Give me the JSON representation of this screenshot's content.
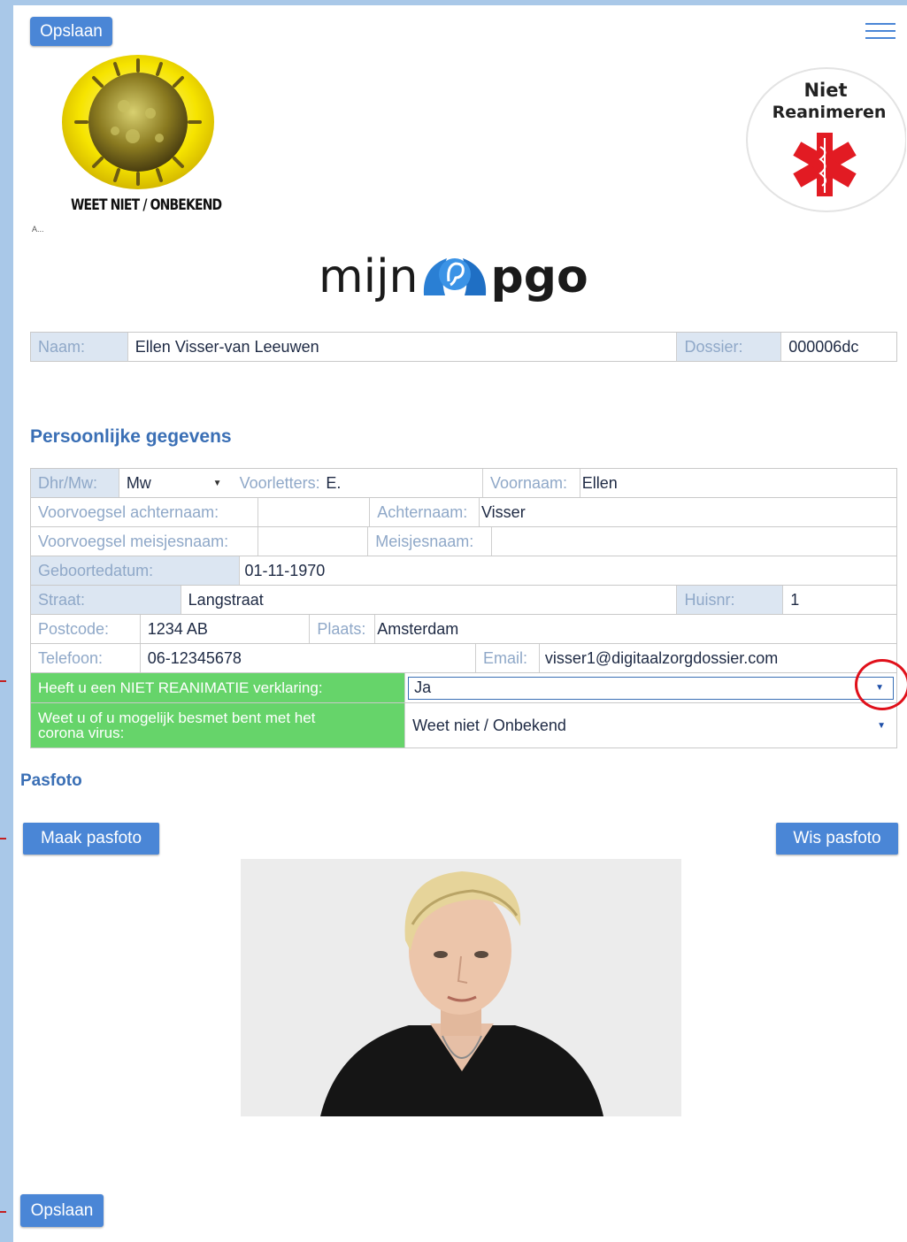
{
  "toolbar": {
    "save_label": "Opslaan"
  },
  "badges": {
    "corona_label": "WEET NIET / ONBEKEND",
    "tiny_mark": "A...",
    "nr_line1": "Niet",
    "nr_line2": "Reanimeren"
  },
  "logo": {
    "word1": "mijn",
    "word2": "pgo"
  },
  "header": {
    "naam_label": "Naam:",
    "naam_value": "Ellen Visser-van Leeuwen",
    "dossier_label": "Dossier:",
    "dossier_value": "000006dc"
  },
  "section_title": "Persoonlijke gegevens",
  "form": {
    "dhr_label": "Dhr/Mw:",
    "dhr_value": "Mw",
    "voorletters_label": "Voorletters:",
    "voorletters_value": "E.",
    "voornaam_label": "Voornaam:",
    "voornaam_value": "Ellen",
    "voorvoegsel_achternaam_label": "Voorvoegsel achternaam:",
    "voorvoegsel_achternaam_value": "",
    "achternaam_label": "Achternaam:",
    "achternaam_value": "Visser",
    "voorvoegsel_meisjesnaam_label": "Voorvoegsel meisjesnaam:",
    "voorvoegsel_meisjesnaam_value": "",
    "meisjesnaam_label": "Meisjesnaam:",
    "meisjesnaam_value": "",
    "geboortedatum_label": "Geboortedatum:",
    "geboortedatum_value": "01-11-1970",
    "straat_label": "Straat:",
    "straat_value": "Langstraat",
    "huisnr_label": "Huisnr:",
    "huisnr_value": "1",
    "postcode_label": "Postcode:",
    "postcode_value": "1234  AB",
    "plaats_label": "Plaats:",
    "plaats_value": "Amsterdam",
    "telefoon_label": "Telefoon:",
    "telefoon_value": "06-12345678",
    "email_label": "Email:",
    "email_value": "visser1@digitaalzorgdossier.com",
    "reanimatie_label": "Heeft u een NIET REANIMATIE verklaring:",
    "reanimatie_value": "Ja",
    "corona_label_line1": "Weet u of u mogelijk besmet bent met het",
    "corona_label_line2": "corona virus:",
    "corona_value": "Weet niet / Onbekend"
  },
  "pasfoto": {
    "title": "Pasfoto",
    "make_label": "Maak pasfoto",
    "clear_label": "Wis pasfoto"
  },
  "colors": {
    "accent": "#4a86d6",
    "label_bg": "#dce6f2",
    "green": "#66d46a",
    "highlight": "#e0101a"
  }
}
